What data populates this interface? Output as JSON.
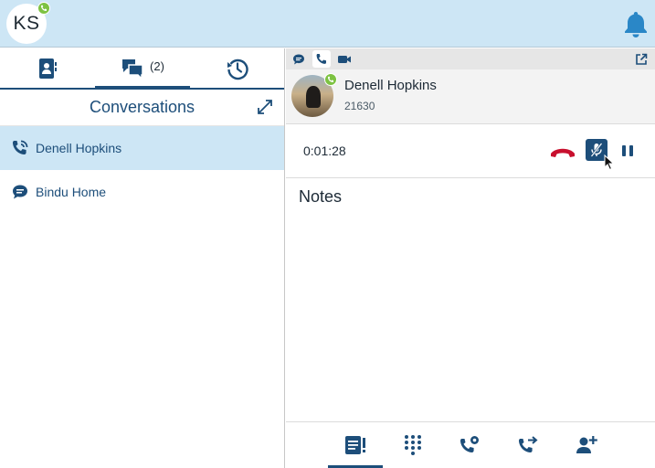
{
  "header": {
    "user_initials": "KS",
    "user_presence": "available-on-call",
    "bell_icon": "bell-icon"
  },
  "left_panel": {
    "tabs": [
      {
        "icon": "contacts-icon",
        "label": ""
      },
      {
        "icon": "conversations-icon",
        "count": "(2)"
      },
      {
        "icon": "history-icon",
        "label": ""
      }
    ],
    "title": "Conversations",
    "items": [
      {
        "name": "Denell Hopkins",
        "icon": "active-call-icon",
        "active": true
      },
      {
        "name": "Bindu Home",
        "icon": "chat-icon",
        "active": false
      }
    ]
  },
  "right_panel": {
    "mode_icons": [
      "chat-icon",
      "phone-icon",
      "video-icon"
    ],
    "contact": {
      "name": "Denell Hopkins",
      "extension": "21630"
    },
    "call": {
      "timer": "0:01:28"
    },
    "notes_title": "Notes",
    "bottom_actions": [
      "notes-icon",
      "dialpad-icon",
      "voicemail-transfer-icon",
      "transfer-icon",
      "add-participant-icon"
    ]
  },
  "colors": {
    "accent": "#1d4e7a",
    "header_bg": "#cde6f5",
    "presence": "#7dc242",
    "hangup": "#c8102e"
  }
}
